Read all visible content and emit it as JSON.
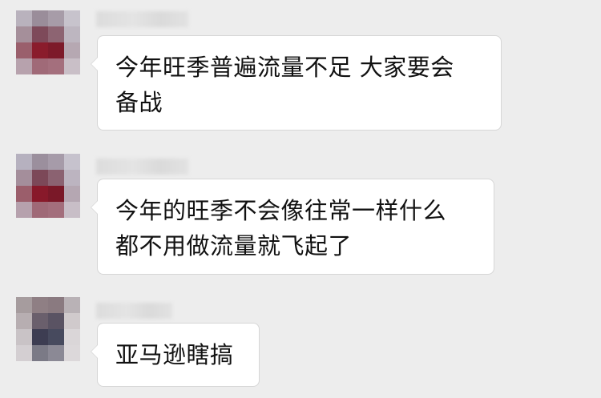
{
  "messages": [
    {
      "sender": "",
      "avatar_icon": "blurred-avatar-icon",
      "lines": [
        "今年旺季普遍流量不足 大家要会",
        "备战"
      ]
    },
    {
      "sender": "",
      "avatar_icon": "blurred-avatar-icon",
      "lines": [
        "今年的旺季不会像往常一样什么",
        "都不用做流量就飞起了"
      ]
    },
    {
      "sender": "",
      "avatar_icon": "blurred-avatar-icon",
      "lines": [
        "亚马逊瞎搞"
      ]
    }
  ],
  "colors": {
    "background": "#ededed",
    "bubble": "#ffffff",
    "bubble_border": "#d6d6d6",
    "text": "#111111"
  }
}
